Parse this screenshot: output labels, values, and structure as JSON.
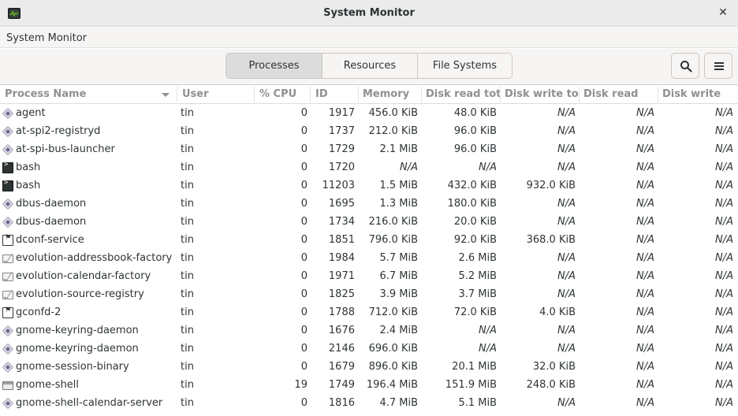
{
  "window": {
    "title": "System Monitor"
  },
  "menubar": {
    "app_menu": "System Monitor"
  },
  "toolbar": {
    "tabs": [
      {
        "label": "Processes",
        "active": true
      },
      {
        "label": "Resources",
        "active": false
      },
      {
        "label": "File Systems",
        "active": false
      }
    ]
  },
  "columns": {
    "name": "Process Name",
    "user": "User",
    "cpu": "% CPU",
    "id": "ID",
    "memory": "Memory",
    "disk_read_total": "Disk read tot",
    "disk_write_total": "Disk write to",
    "disk_read": "Disk read",
    "disk_write": "Disk write"
  },
  "processes": [
    {
      "icon": "gear",
      "name": "agent",
      "user": "tin",
      "cpu": "0",
      "id": "1917",
      "memory": "456.0 KiB",
      "disk_read_total": "48.0 KiB",
      "disk_write_total": "N/A",
      "disk_read": "N/A",
      "disk_write": "N/A"
    },
    {
      "icon": "gear",
      "name": "at-spi2-registryd",
      "user": "tin",
      "cpu": "0",
      "id": "1737",
      "memory": "212.0 KiB",
      "disk_read_total": "96.0 KiB",
      "disk_write_total": "N/A",
      "disk_read": "N/A",
      "disk_write": "N/A"
    },
    {
      "icon": "gear",
      "name": "at-spi-bus-launcher",
      "user": "tin",
      "cpu": "0",
      "id": "1729",
      "memory": "2.1 MiB",
      "disk_read_total": "96.0 KiB",
      "disk_write_total": "N/A",
      "disk_read": "N/A",
      "disk_write": "N/A"
    },
    {
      "icon": "terminal",
      "name": "bash",
      "user": "tin",
      "cpu": "0",
      "id": "1720",
      "memory": "N/A",
      "disk_read_total": "N/A",
      "disk_write_total": "N/A",
      "disk_read": "N/A",
      "disk_write": "N/A"
    },
    {
      "icon": "terminal",
      "name": "bash",
      "user": "tin",
      "cpu": "0",
      "id": "11203",
      "memory": "1.5 MiB",
      "disk_read_total": "432.0 KiB",
      "disk_write_total": "932.0 KiB",
      "disk_read": "N/A",
      "disk_write": "N/A"
    },
    {
      "icon": "gear",
      "name": "dbus-daemon",
      "user": "tin",
      "cpu": "0",
      "id": "1695",
      "memory": "1.3 MiB",
      "disk_read_total": "180.0 KiB",
      "disk_write_total": "N/A",
      "disk_read": "N/A",
      "disk_write": "N/A"
    },
    {
      "icon": "gear",
      "name": "dbus-daemon",
      "user": "tin",
      "cpu": "0",
      "id": "1734",
      "memory": "216.0 KiB",
      "disk_read_total": "20.0 KiB",
      "disk_write_total": "N/A",
      "disk_read": "N/A",
      "disk_write": "N/A"
    },
    {
      "icon": "dconf",
      "name": "dconf-service",
      "user": "tin",
      "cpu": "0",
      "id": "1851",
      "memory": "796.0 KiB",
      "disk_read_total": "92.0 KiB",
      "disk_write_total": "368.0 KiB",
      "disk_read": "N/A",
      "disk_write": "N/A"
    },
    {
      "icon": "mail",
      "name": "evolution-addressbook-factory",
      "user": "tin",
      "cpu": "0",
      "id": "1984",
      "memory": "5.7 MiB",
      "disk_read_total": "2.6 MiB",
      "disk_write_total": "N/A",
      "disk_read": "N/A",
      "disk_write": "N/A"
    },
    {
      "icon": "mail",
      "name": "evolution-calendar-factory",
      "user": "tin",
      "cpu": "0",
      "id": "1971",
      "memory": "6.7 MiB",
      "disk_read_total": "5.2 MiB",
      "disk_write_total": "N/A",
      "disk_read": "N/A",
      "disk_write": "N/A"
    },
    {
      "icon": "mail",
      "name": "evolution-source-registry",
      "user": "tin",
      "cpu": "0",
      "id": "1825",
      "memory": "3.9 MiB",
      "disk_read_total": "3.7 MiB",
      "disk_write_total": "N/A",
      "disk_read": "N/A",
      "disk_write": "N/A"
    },
    {
      "icon": "dconf",
      "name": "gconfd-2",
      "user": "tin",
      "cpu": "0",
      "id": "1788",
      "memory": "712.0 KiB",
      "disk_read_total": "72.0 KiB",
      "disk_write_total": "4.0 KiB",
      "disk_read": "N/A",
      "disk_write": "N/A"
    },
    {
      "icon": "gear",
      "name": "gnome-keyring-daemon",
      "user": "tin",
      "cpu": "0",
      "id": "1676",
      "memory": "2.4 MiB",
      "disk_read_total": "N/A",
      "disk_write_total": "N/A",
      "disk_read": "N/A",
      "disk_write": "N/A"
    },
    {
      "icon": "gear",
      "name": "gnome-keyring-daemon",
      "user": "tin",
      "cpu": "0",
      "id": "2146",
      "memory": "696.0 KiB",
      "disk_read_total": "N/A",
      "disk_write_total": "N/A",
      "disk_read": "N/A",
      "disk_write": "N/A"
    },
    {
      "icon": "gear",
      "name": "gnome-session-binary",
      "user": "tin",
      "cpu": "0",
      "id": "1679",
      "memory": "896.0 KiB",
      "disk_read_total": "20.1 MiB",
      "disk_write_total": "32.0 KiB",
      "disk_read": "N/A",
      "disk_write": "N/A"
    },
    {
      "icon": "window",
      "name": "gnome-shell",
      "user": "tin",
      "cpu": "19",
      "id": "1749",
      "memory": "196.4 MiB",
      "disk_read_total": "151.9 MiB",
      "disk_write_total": "248.0 KiB",
      "disk_read": "N/A",
      "disk_write": "N/A"
    },
    {
      "icon": "gear",
      "name": "gnome-shell-calendar-server",
      "user": "tin",
      "cpu": "0",
      "id": "1816",
      "memory": "4.7 MiB",
      "disk_read_total": "5.1 MiB",
      "disk_write_total": "N/A",
      "disk_read": "N/A",
      "disk_write": "N/A"
    }
  ]
}
